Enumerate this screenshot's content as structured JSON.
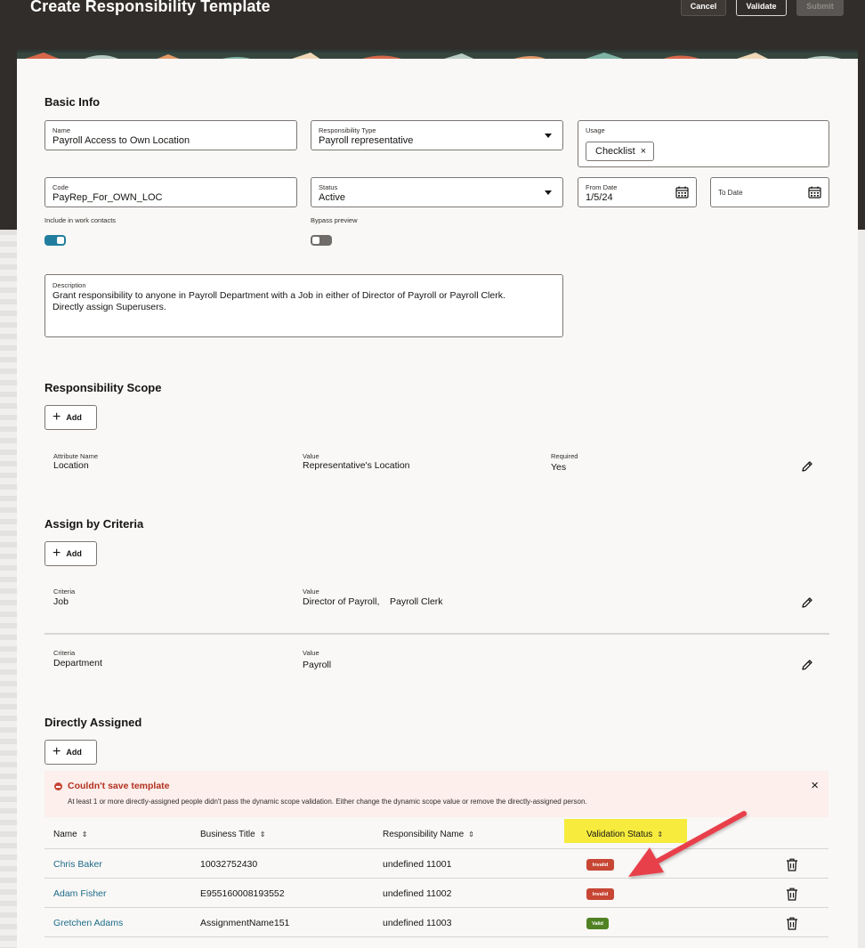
{
  "header": {
    "title": "Create Responsibility Template",
    "cancel_label": "Cancel",
    "validate_label": "Validate",
    "submit_label": "Submit"
  },
  "basic_info": {
    "heading": "Basic Info",
    "name": {
      "label": "Name",
      "value": "Payroll Access to Own Location"
    },
    "responsibility_type": {
      "label": "Responsibility Type",
      "value": "Payroll representative"
    },
    "usage": {
      "label": "Usage",
      "chips": [
        "Checklist"
      ]
    },
    "code": {
      "label": "Code",
      "value": "PayRep_For_OWN_LOC"
    },
    "status": {
      "label": "Status",
      "value": "Active"
    },
    "from_date": {
      "label": "From Date",
      "value": "1/5/24"
    },
    "to_date": {
      "label": "To Date",
      "value": ""
    },
    "include_in_work_contacts": {
      "label": "Include in work contacts",
      "on": true
    },
    "bypass_preview": {
      "label": "Bypass preview",
      "on": false
    },
    "description": {
      "label": "Description",
      "line1": "Grant responsibility to anyone in Payroll Department with a Job in either of Director of Payroll or Payroll Clerk.",
      "line2": "Directly assign Superusers."
    }
  },
  "responsibility_scope": {
    "heading": "Responsibility Scope",
    "add_label": "Add",
    "rows": [
      {
        "attribute_label": "Attribute Name",
        "attribute": "Location",
        "value_label": "Value",
        "value": "Representative's Location",
        "required_label": "Required",
        "required": "Yes"
      }
    ]
  },
  "assign_by_criteria": {
    "heading": "Assign by Criteria",
    "add_label": "Add",
    "rows": [
      {
        "criteria_label": "Criteria",
        "criteria": "Job",
        "value_label": "Value",
        "value": "Director of Payroll,    Payroll Clerk"
      },
      {
        "criteria_label": "Criteria",
        "criteria": "Department",
        "value_label": "Value",
        "value": "Payroll"
      }
    ]
  },
  "directly_assigned": {
    "heading": "Directly Assigned",
    "add_label": "Add",
    "error": {
      "title": "Couldn't save template",
      "message": "At least 1 or more directly-assigned people didn't pass the dynamic scope validation. Either change the dynamic scope value or remove the directly-assigned person."
    },
    "columns": [
      "Name",
      "Business Title",
      "Responsibility Name",
      "Validation Status"
    ],
    "rows": [
      {
        "name": "Chris Baker",
        "business_title": "10032752430",
        "responsibility_name": "undefined 11001",
        "status": "Invalid"
      },
      {
        "name": "Adam Fisher",
        "business_title": "E955160008193552",
        "responsibility_name": "undefined 11002",
        "status": "Invalid"
      },
      {
        "name": "Gretchen Adams",
        "business_title": "AssignmentName151",
        "responsibility_name": "undefined 11003",
        "status": "Valid"
      }
    ]
  },
  "colors": {
    "header_bg": "#312d2a",
    "toggle_on": "#227e9e",
    "link": "#1d6b8a",
    "invalid": "#c74634",
    "valid": "#508223",
    "highlight": "#f7ec3d",
    "annotation_arrow": "#e8414b"
  },
  "icons": [
    "calendar-icon",
    "chevron-down-icon",
    "plus-icon",
    "edit-pencil-icon",
    "error-icon",
    "close-icon",
    "sort-icon",
    "trash-icon"
  ]
}
